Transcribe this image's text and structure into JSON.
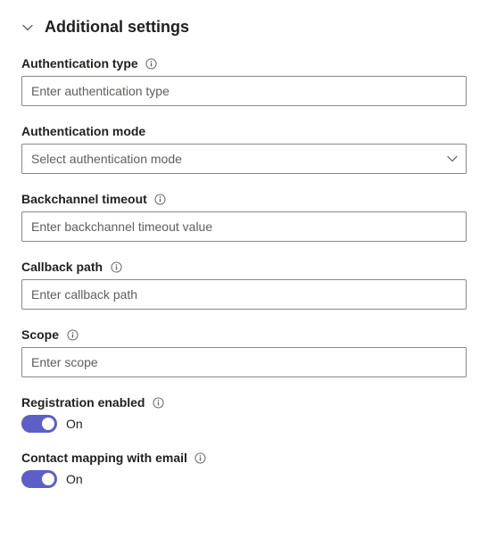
{
  "section": {
    "title": "Additional settings"
  },
  "fields": {
    "auth_type": {
      "label": "Authentication type",
      "placeholder": "Enter authentication type"
    },
    "auth_mode": {
      "label": "Authentication mode",
      "placeholder": "Select authentication mode"
    },
    "backchannel_timeout": {
      "label": "Backchannel timeout",
      "placeholder": "Enter backchannel timeout value"
    },
    "callback_path": {
      "label": "Callback path",
      "placeholder": "Enter callback path"
    },
    "scope": {
      "label": "Scope",
      "placeholder": "Enter scope"
    },
    "registration_enabled": {
      "label": "Registration enabled",
      "status": "On"
    },
    "contact_mapping": {
      "label": "Contact mapping with email",
      "status": "On"
    }
  }
}
